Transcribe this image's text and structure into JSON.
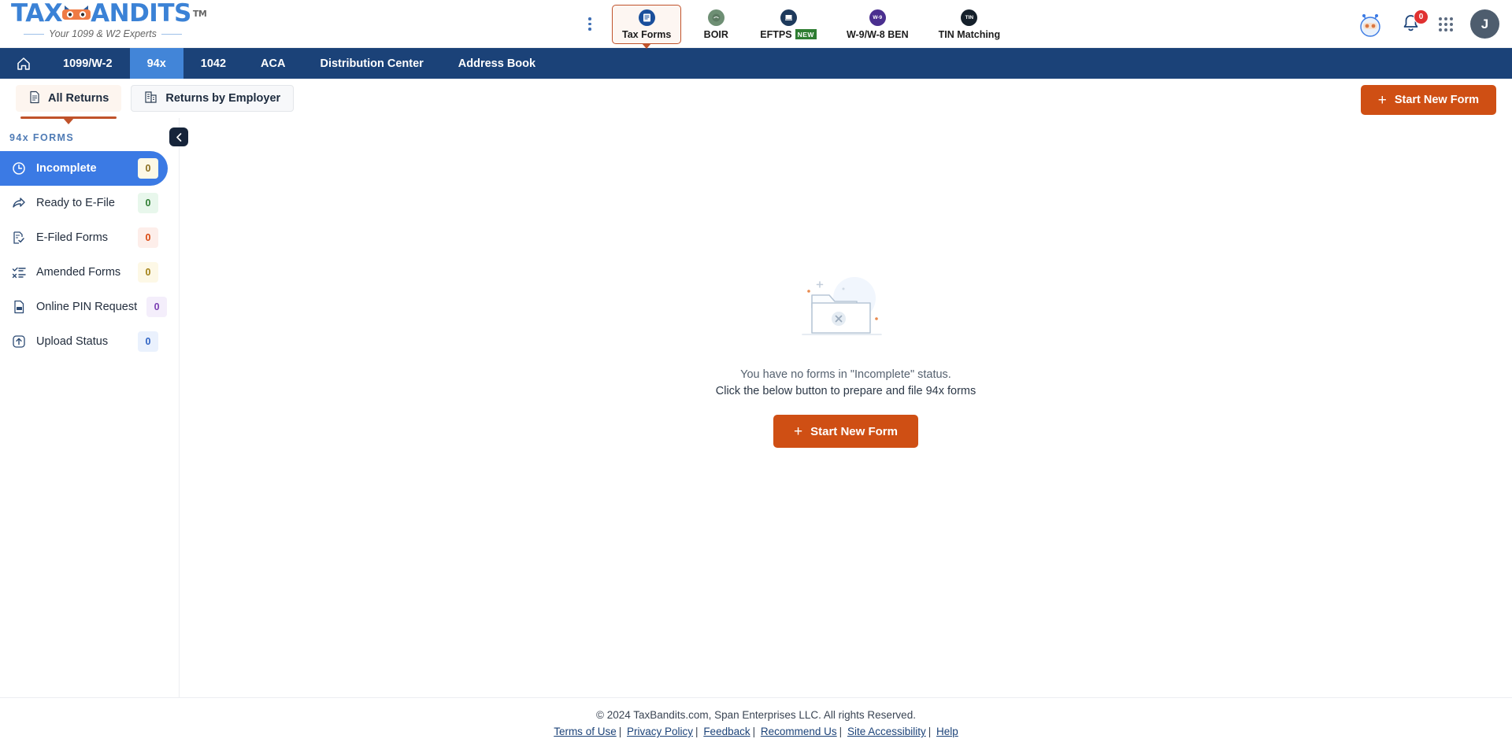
{
  "brand": {
    "name_part1": "TAX",
    "name_part2": "ANDITS",
    "tm": "TM",
    "tagline": "Your 1099 & W2 Experts"
  },
  "topnav": {
    "kebab_label": "more-options",
    "items": [
      {
        "label": "Tax Forms",
        "icon": "tax-forms-icon",
        "active": true,
        "badge": ""
      },
      {
        "label": "BOIR",
        "icon": "boir-icon",
        "active": false,
        "badge": ""
      },
      {
        "label": "EFTPS",
        "icon": "eftps-icon",
        "active": false,
        "badge": "NEW"
      },
      {
        "label": "W-9/W-8 BEN",
        "icon": "w9-icon",
        "active": false,
        "badge": ""
      },
      {
        "label": "TIN Matching",
        "icon": "tin-icon",
        "active": false,
        "badge": ""
      }
    ],
    "notification_count": "0",
    "avatar_initial": "J"
  },
  "bluenav": {
    "home_icon": "home-icon",
    "items": [
      {
        "label": "1099/W-2",
        "selected": false
      },
      {
        "label": "94x",
        "selected": true
      },
      {
        "label": "1042",
        "selected": false
      },
      {
        "label": "ACA",
        "selected": false
      },
      {
        "label": "Distribution Center",
        "selected": false
      },
      {
        "label": "Address Book",
        "selected": false
      }
    ]
  },
  "tabs": {
    "all_returns": "All Returns",
    "returns_by_employer": "Returns by Employer",
    "start_new_form": "Start New Form"
  },
  "sidebar": {
    "title": "94x FORMS",
    "collapse_icon": "chevron-left-icon",
    "items": [
      {
        "label": "Incomplete",
        "count": "0",
        "icon": "clock-icon",
        "active": true,
        "badge_bg": "#fdf8e6",
        "badge_fg": "#8a6d1f"
      },
      {
        "label": "Ready to E-File",
        "count": "0",
        "icon": "share-arrow-icon",
        "active": false,
        "badge_bg": "#e8f7ec",
        "badge_fg": "#2e7d32"
      },
      {
        "label": "E-Filed Forms",
        "count": "0",
        "icon": "file-check-icon",
        "active": false,
        "badge_bg": "#fdeeea",
        "badge_fg": "#d9480f"
      },
      {
        "label": "Amended Forms",
        "count": "0",
        "icon": "amend-icon",
        "active": false,
        "badge_bg": "#fdf8e6",
        "badge_fg": "#a17f12"
      },
      {
        "label": "Online PIN Request",
        "count": "0",
        "icon": "pin-doc-icon",
        "active": false,
        "badge_bg": "#f4eefb",
        "badge_fg": "#7b3fb3"
      },
      {
        "label": "Upload Status",
        "count": "0",
        "icon": "upload-icon",
        "active": false,
        "badge_bg": "#eaf1fd",
        "badge_fg": "#2f63c4"
      }
    ]
  },
  "empty_state": {
    "illustration": "empty-folder-icon",
    "line1": "You have no forms in \"Incomplete\" status.",
    "line2": "Click the below button to prepare and file 94x forms",
    "button": "Start New Form"
  },
  "footer": {
    "copyright": "© 2024 TaxBandits.com, Span Enterprises LLC. All rights Reserved.",
    "links": [
      "Terms of Use",
      "Privacy Policy",
      "Feedback",
      "Recommend Us",
      "Site Accessibility",
      "Help"
    ],
    "separator": "|"
  },
  "colors": {
    "brand_blue": "#3b82d6",
    "nav_blue": "#1b4278",
    "nav_selected": "#4285d8",
    "accent_orange": "#cf4f14",
    "sidebar_active": "#3b7ae4"
  }
}
